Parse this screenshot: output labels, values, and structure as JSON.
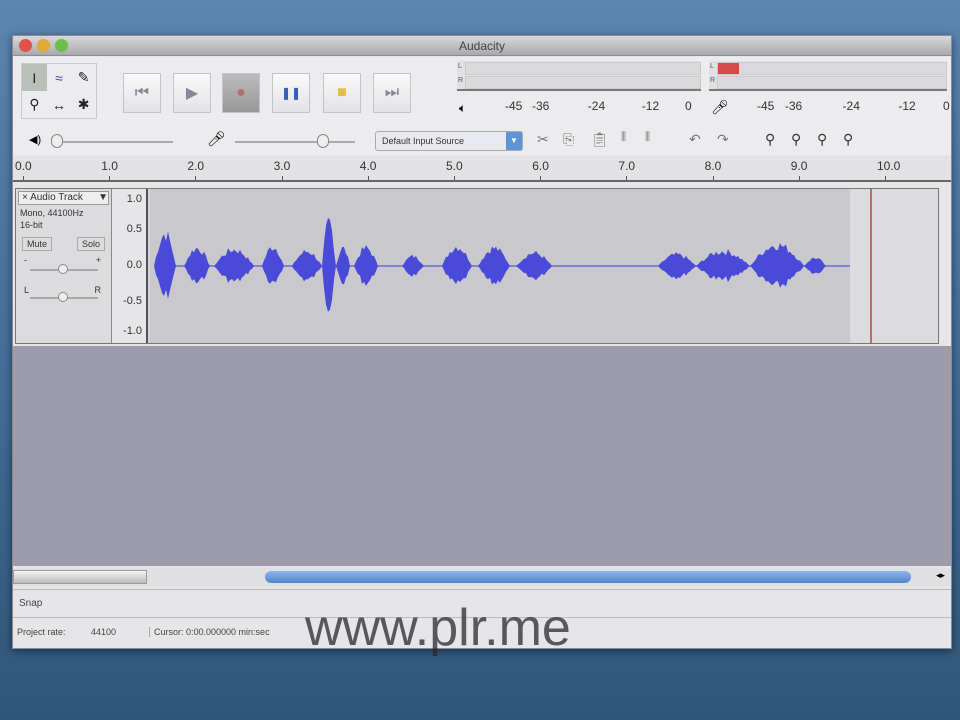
{
  "window": {
    "title": "Audacity"
  },
  "toolbar": {
    "tools": [
      {
        "name": "selection-tool",
        "glyph": "I"
      },
      {
        "name": "envelope-tool",
        "glyph": "≈"
      },
      {
        "name": "draw-tool",
        "glyph": "✎"
      },
      {
        "name": "zoom-tool",
        "glyph": "⚲"
      },
      {
        "name": "timeshift-tool",
        "glyph": "↔"
      },
      {
        "name": "multi-tool",
        "glyph": "✱"
      }
    ],
    "transport": [
      {
        "name": "skip-start-button",
        "glyph": "⏮"
      },
      {
        "name": "play-button",
        "glyph": "▶"
      },
      {
        "name": "record-button",
        "glyph": "●"
      },
      {
        "name": "pause-button",
        "glyph": "❚❚"
      },
      {
        "name": "stop-button",
        "glyph": "■"
      },
      {
        "name": "skip-end-button",
        "glyph": "⏭"
      }
    ],
    "meter_scale": [
      "-45",
      "-36",
      "-24",
      "-12",
      "0"
    ],
    "meter_channels": [
      "L",
      "R"
    ],
    "record_level_fraction": 0.09,
    "input_source": "Default Input Source"
  },
  "ruler": {
    "ticks": [
      "0.0",
      "1.0",
      "2.0",
      "3.0",
      "4.0",
      "5.0",
      "6.0",
      "7.0",
      "8.0",
      "9.0",
      "10.0"
    ]
  },
  "track": {
    "name": "Audio Track",
    "info1": "Mono, 44100Hz",
    "info2": "16-bit",
    "mute": "Mute",
    "solo": "Solo",
    "pan_left": "L",
    "pan_right": "R",
    "gain_minus": "-",
    "gain_plus": "+",
    "scale": [
      "1.0",
      "0.5",
      "0.0",
      "-0.5",
      "-1.0"
    ],
    "wave_color": "#4a4ad8"
  },
  "bottom": {
    "snap": "Snap",
    "project_rate_label": "Project rate:",
    "project_rate": "44100",
    "cursor": "Cursor: 0:00.000000 min:sec"
  },
  "watermark": "www.plr.me"
}
